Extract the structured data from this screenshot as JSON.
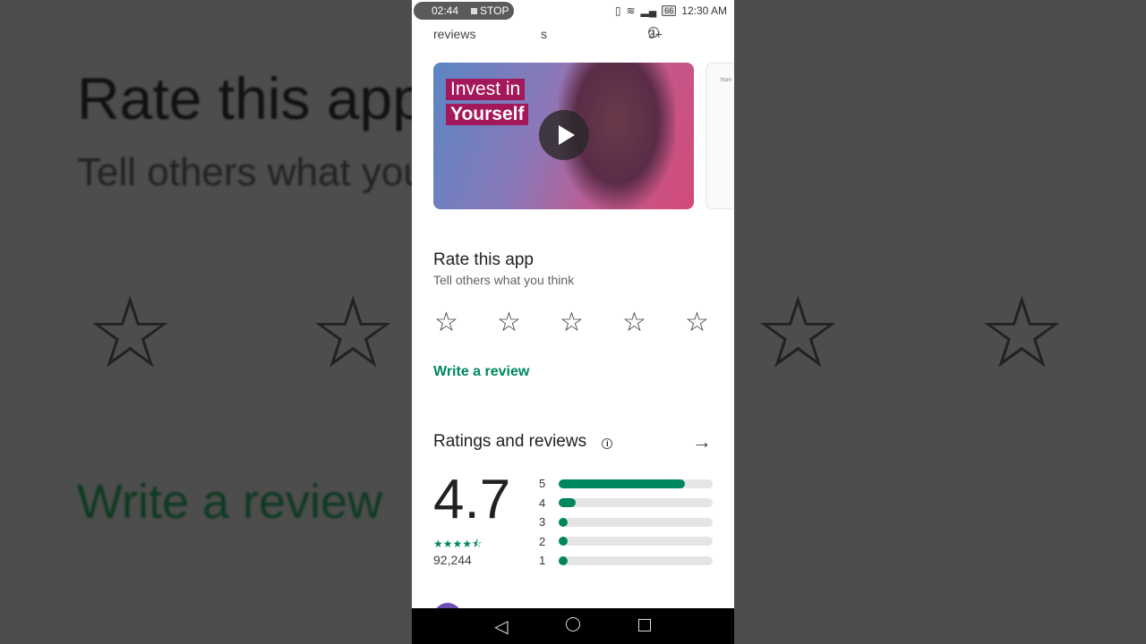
{
  "status_bar": {
    "recording_time": "02:44",
    "stop_label": "STOP",
    "battery": "66",
    "time": "12:30 AM"
  },
  "top_row": {
    "reviews": "reviews",
    "size": "s",
    "age_rating": "3+"
  },
  "video": {
    "line1": "Invest in",
    "line2": "Yourself",
    "screenshot2_text": "from"
  },
  "rate": {
    "title": "Rate this app",
    "subtitle": "Tell others what you think",
    "stars": [
      "☆",
      "☆",
      "☆",
      "☆",
      "☆"
    ],
    "write_review": "Write a review"
  },
  "ratings": {
    "title": "Ratings and reviews",
    "score": "4.7",
    "stars": "★★★★⯪",
    "count": "92,244",
    "bars": [
      {
        "label": "5",
        "percent": 82
      },
      {
        "label": "4",
        "percent": 11
      },
      {
        "label": "3",
        "percent": 3
      },
      {
        "label": "2",
        "percent": 3
      },
      {
        "label": "1",
        "percent": 3
      }
    ],
    "accent": "#01875f"
  },
  "nav": {
    "back": "◁"
  }
}
